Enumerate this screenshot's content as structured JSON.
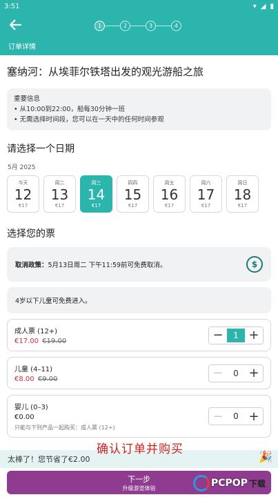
{
  "statusbar": {
    "time": "3:51",
    "wifi_icon": "wifi-icon",
    "signal_icon": "signal-icon",
    "battery_icon": "battery-icon"
  },
  "header": {
    "back_icon": "back-arrow-icon",
    "steps": [
      "1",
      "2",
      "3",
      "4"
    ],
    "active_step": 1,
    "label": "订单详情"
  },
  "product": {
    "title": "塞纳河：从埃菲尔铁塔出发的观光游船之旅"
  },
  "important": {
    "heading": "重要信息",
    "items": [
      "从10:00到22:00，船每30分钟一班",
      "无需选择时间段，您可以在一天中的任何时间参观"
    ]
  },
  "date_section": {
    "title": "请选择一个日期",
    "month": "5月 2025",
    "dates": [
      {
        "weekday": "今天",
        "day": "12",
        "price": "€17",
        "selected": false
      },
      {
        "weekday": "周二",
        "day": "13",
        "price": "€17",
        "selected": false
      },
      {
        "weekday": "周三",
        "day": "14",
        "price": "€17",
        "selected": true
      },
      {
        "weekday": "四四",
        "day": "15",
        "price": "€17",
        "selected": false
      },
      {
        "weekday": "周五",
        "day": "16",
        "price": "€17",
        "selected": false
      },
      {
        "weekday": "周六",
        "day": "17",
        "price": "€17",
        "selected": false
      },
      {
        "weekday": "周日",
        "day": "18",
        "price": "€17",
        "selected": false
      }
    ]
  },
  "tickets_section": {
    "title": "选择您的票",
    "policy_label": "取消政策：",
    "policy_text": "5月13日周二 下午11:59前可免费取消。",
    "policy_icon": "money-refund-icon",
    "free_note": "4岁以下儿童可免费进入。",
    "tickets": [
      {
        "name": "成人票 (12+)",
        "price": "€17.00",
        "old_price": "€19.00",
        "qty": "1",
        "note": ""
      },
      {
        "name": "儿童 (4–11)",
        "price": "€8.00",
        "old_price": "€9.00",
        "qty": "0",
        "note": ""
      },
      {
        "name": "婴儿 (0–3)",
        "price": "€0.00",
        "old_price": "",
        "qty": "0",
        "note": "只能与下列产品一起购买：成人票 (12+)"
      }
    ]
  },
  "overlay_text": "确认订单并购买",
  "savings": {
    "text": "太棒了！您节省了€2.00",
    "icon": "party-popper-icon"
  },
  "next_button": {
    "label": "下一步",
    "sublabel": "升级游览体验"
  },
  "watermark": {
    "brand": "PCPOP",
    "suffix": "下载"
  },
  "colors": {
    "primary": "#2bb5ad",
    "button": "#8f3b8f",
    "sale": "#d12c3b",
    "overlay": "#d22121"
  }
}
